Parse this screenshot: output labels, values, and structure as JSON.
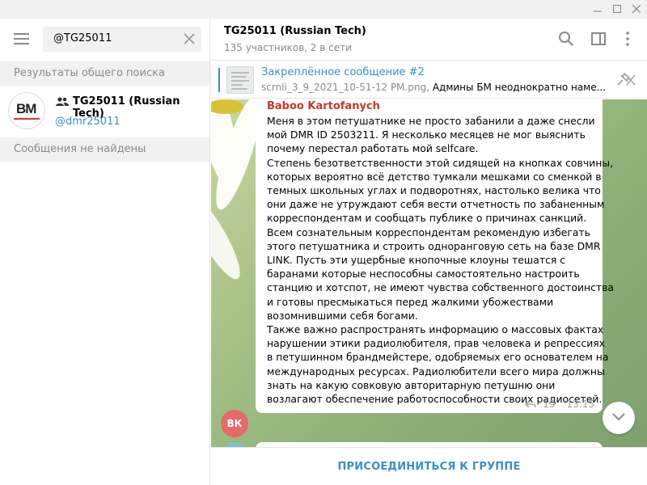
{
  "window": {
    "controls": [
      "minimize-icon",
      "maximize-icon",
      "close-icon"
    ]
  },
  "sidebar": {
    "search": {
      "value": "@TG25011"
    },
    "global_results_header": "Результаты общего поиска",
    "result": {
      "avatar_text": "BM",
      "name": "TG25011 (Russian Tech)",
      "handle": "@dmr25011"
    },
    "messages_header": "Сообщения не найдены"
  },
  "chat": {
    "title": "TG25011 (Russian Tech)",
    "subtitle": "135 участников, 2 в сети",
    "pinned": {
      "title": "Закреплённое сообщение #2",
      "file": "scrnli_3_9_2021_10-51-12 PM.png,",
      "text": "Админы БМ неоднократно наме..."
    },
    "message": {
      "sender": "Baboo Kartofanych",
      "lines": [
        "Меня в этом петушатнике не просто забанили а даже снесли",
        "мой DMR ID 2503211. Я несколько месяцев не мог выяснить",
        "почему перестал работать мой selfcare.",
        "Степень безответственности этой сидящей на кнопках совчины,",
        "которых вероятно всё детство тумкали мешками со сменкой в",
        "темных школьных углах и подворотнях, настолько велика что",
        "они даже не утруждают себя вести отчетность по забаненным",
        "корреспондентам и сообщать публике о причинах санкций.",
        "Всем сознательным корреспондентам рекомендую избегать",
        "этого петушатника и строить одноранговую сеть на базе DMR",
        "LINK. Пусть эти ущербные кнопочные клоуны тешатся с",
        "баранами которые неспособны самостоятельно настроить",
        "станцию и хотспот, не имеют чувства собственного достоинства",
        "и готовы пресмыкаться перед жалкими убожествами",
        "возомнившими себя богами.",
        "Также важно распространять информацию о массовых фактах",
        "нарушении этики радиолюбителя, прав человека и репрессиях",
        "в петушинном брандмейстере, одобряемых его основателем на",
        "международных ресурсах. Радиолюбители всего мира должны",
        "знать на какую совковую авторитарную петушню они",
        "возлагают обеспечение работоспособности своих радиосетей."
      ],
      "replies": "19",
      "time": "13:15",
      "avatar_text": "ВК"
    },
    "join_button": "ПРИСОЕДИНИТЬСЯ К ГРУППЕ"
  },
  "colors": {
    "accent": "#3a8fc7",
    "sender": "#c0392b",
    "avatar_bk": "#e56a6a"
  }
}
